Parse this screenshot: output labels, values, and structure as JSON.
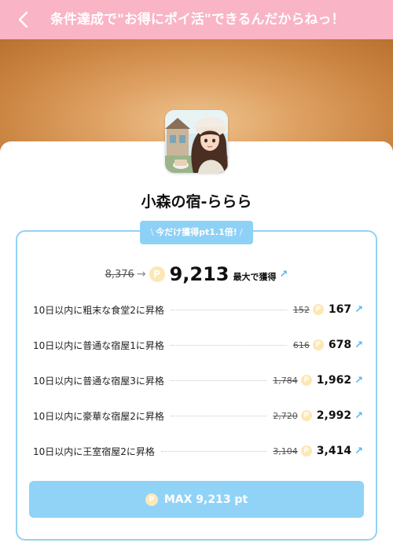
{
  "header": {
    "title": "条件達成で\"お得にポイ活\"できるんだからねっ！",
    "background": "#f9b4c6"
  },
  "app": {
    "name": "小森の宿-ららら",
    "icon": "anime-girl-app-icon"
  },
  "promo": {
    "slash": "\\",
    "label": "今だけ獲得pt1.1倍!",
    "slash_end": "/"
  },
  "summary": {
    "old_points": "8,376",
    "arrow": "→",
    "coin": "P",
    "new_points": "9,213",
    "suffix": "最大で獲得"
  },
  "tasks": [
    {
      "label": "10日以内に粗末な食堂2に昇格",
      "old": "152",
      "new": "167"
    },
    {
      "label": "10日以内に普通な宿屋1に昇格",
      "old": "616",
      "new": "678"
    },
    {
      "label": "10日以内に普通な宿屋3に昇格",
      "old": "1,784",
      "new": "1,962"
    },
    {
      "label": "10日以内に豪華な宿屋2に昇格",
      "old": "2,720",
      "new": "2,992"
    },
    {
      "label": "10日以内に王室宿屋2に昇格",
      "old": "3,104",
      "new": "3,414"
    }
  ],
  "button": {
    "label": "MAX 9,213 pt",
    "coin": "P"
  },
  "colors": {
    "accent_blue": "#90d2f5",
    "pink": "#f9b4c6",
    "coin": "#fde7b3"
  },
  "icons": {
    "back": "chevron-left-icon",
    "external": "arrow-up-right-icon",
    "coin": "point-coin-icon"
  }
}
